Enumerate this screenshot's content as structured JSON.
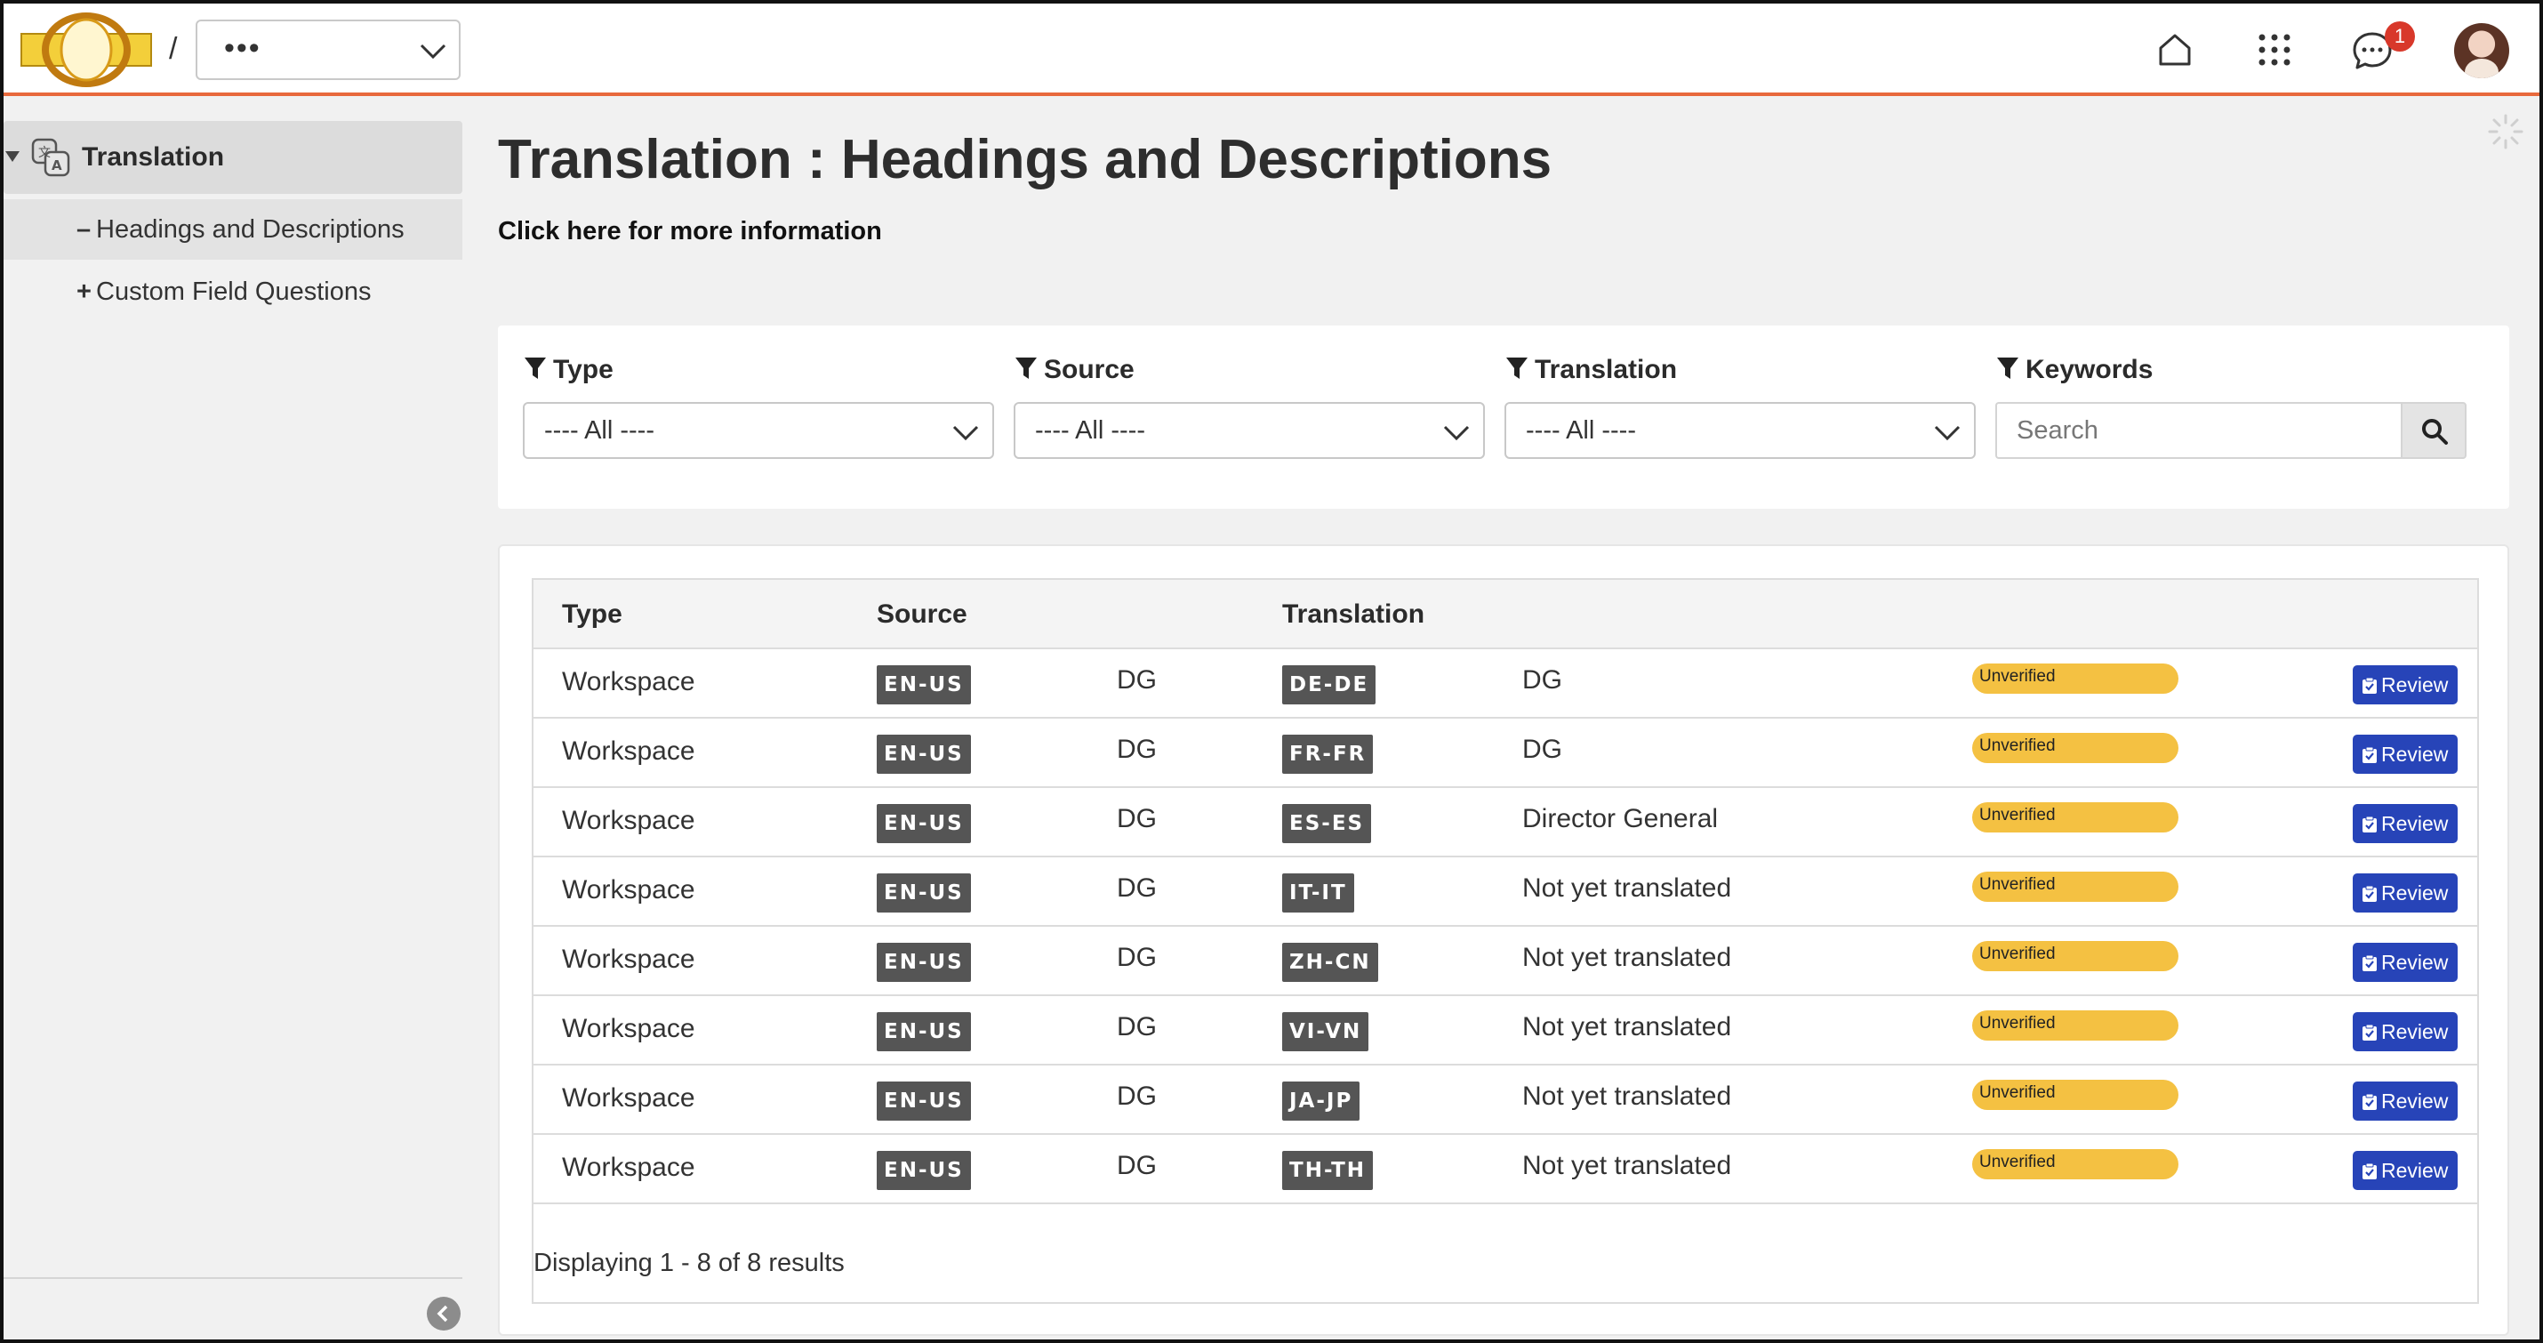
{
  "header": {
    "separator": "/",
    "workspace_value": "•••",
    "notification_count": "1",
    "colors": {
      "accent_line": "#e8693c",
      "badge": "#d8382a"
    },
    "icons": [
      "logo-icon",
      "home-icon",
      "apps-grid-icon",
      "chat-icon",
      "avatar"
    ]
  },
  "sidebar": {
    "root_label": "Translation",
    "items": [
      {
        "marker": "–",
        "label": "Headings and Descriptions",
        "active": true
      },
      {
        "marker": "+",
        "label": "Custom Field Questions",
        "active": false
      }
    ]
  },
  "page": {
    "title": "Translation : Headings and Descriptions",
    "more_info": "Click here for more information"
  },
  "filters": {
    "type": {
      "label": "Type",
      "value": "---- All ----"
    },
    "source": {
      "label": "Source",
      "value": "---- All ----"
    },
    "translation": {
      "label": "Translation",
      "value": "---- All ----"
    },
    "keywords": {
      "label": "Keywords",
      "placeholder": "Search"
    }
  },
  "table": {
    "headers": {
      "type": "Type",
      "source": "Source",
      "translation": "Translation"
    },
    "rows": [
      {
        "type": "Workspace",
        "source_lang": "EN-US",
        "source_text": "DG",
        "target_lang": "DE-DE",
        "target_text": "DG",
        "status": "Unverified",
        "action": "Review"
      },
      {
        "type": "Workspace",
        "source_lang": "EN-US",
        "source_text": "DG",
        "target_lang": "FR-FR",
        "target_text": "DG",
        "status": "Unverified",
        "action": "Review"
      },
      {
        "type": "Workspace",
        "source_lang": "EN-US",
        "source_text": "DG",
        "target_lang": "ES-ES",
        "target_text": "Director General",
        "status": "Unverified",
        "action": "Review"
      },
      {
        "type": "Workspace",
        "source_lang": "EN-US",
        "source_text": "DG",
        "target_lang": "IT-IT",
        "target_text": "Not yet translated",
        "status": "Unverified",
        "action": "Review"
      },
      {
        "type": "Workspace",
        "source_lang": "EN-US",
        "source_text": "DG",
        "target_lang": "ZH-CN",
        "target_text": "Not yet translated",
        "status": "Unverified",
        "action": "Review"
      },
      {
        "type": "Workspace",
        "source_lang": "EN-US",
        "source_text": "DG",
        "target_lang": "VI-VN",
        "target_text": "Not yet translated",
        "status": "Unverified",
        "action": "Review"
      },
      {
        "type": "Workspace",
        "source_lang": "EN-US",
        "source_text": "DG",
        "target_lang": "JA-JP",
        "target_text": "Not yet translated",
        "status": "Unverified",
        "action": "Review"
      },
      {
        "type": "Workspace",
        "source_lang": "EN-US",
        "source_text": "DG",
        "target_lang": "TH-TH",
        "target_text": "Not yet translated",
        "status": "Unverified",
        "action": "Review"
      }
    ],
    "footer": "Displaying 1 - 8 of 8 results",
    "colors": {
      "status": "#f4c142",
      "review_button": "#2744b8",
      "lang_tag": "#555555"
    }
  }
}
